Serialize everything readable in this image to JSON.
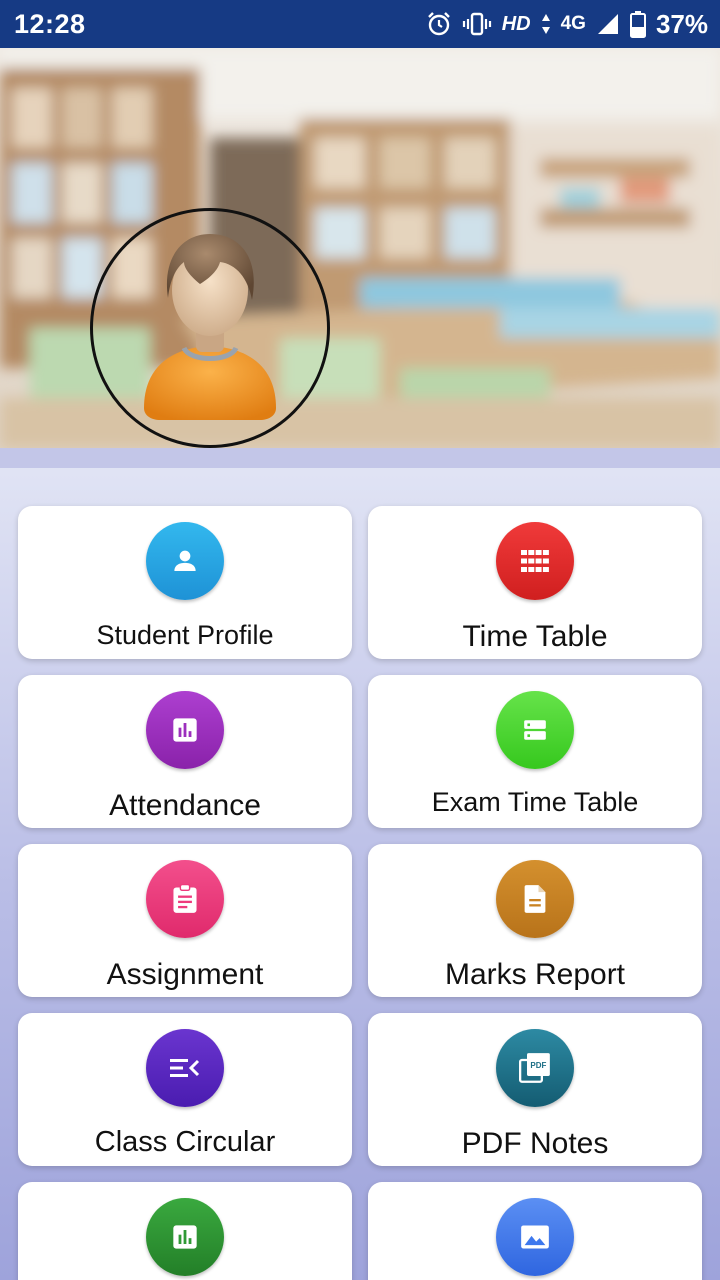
{
  "status_bar": {
    "time": "12:28",
    "network_hd": "HD",
    "network_type": "4G",
    "battery": "37%"
  },
  "profile": {
    "avatar_icon": "student-avatar-icon"
  },
  "menu": [
    {
      "label": "Student Profile",
      "icon": "person-icon",
      "color": "#29a9e6"
    },
    {
      "label": "Time Table",
      "icon": "grid-icon",
      "color": "#e42b2b"
    },
    {
      "label": "Attendance",
      "icon": "bar-chart-icon",
      "color": "#9c2fbd"
    },
    {
      "label": "Exam Time Table",
      "icon": "list-icon",
      "color": "#4fd631"
    },
    {
      "label": "Assignment",
      "icon": "clipboard-icon",
      "color": "#ee3a7c"
    },
    {
      "label": "Marks Report",
      "icon": "document-icon",
      "color": "#c98222"
    },
    {
      "label": "Class Circular",
      "icon": "circular-icon",
      "color": "#5b24c0"
    },
    {
      "label": "PDF Notes",
      "icon": "pdf-icon",
      "color": "#1d6f86"
    },
    {
      "label": "",
      "icon": "bar-chart-icon",
      "color": "#2f9a35"
    },
    {
      "label": "",
      "icon": "image-icon",
      "color": "#3d78ee"
    }
  ]
}
